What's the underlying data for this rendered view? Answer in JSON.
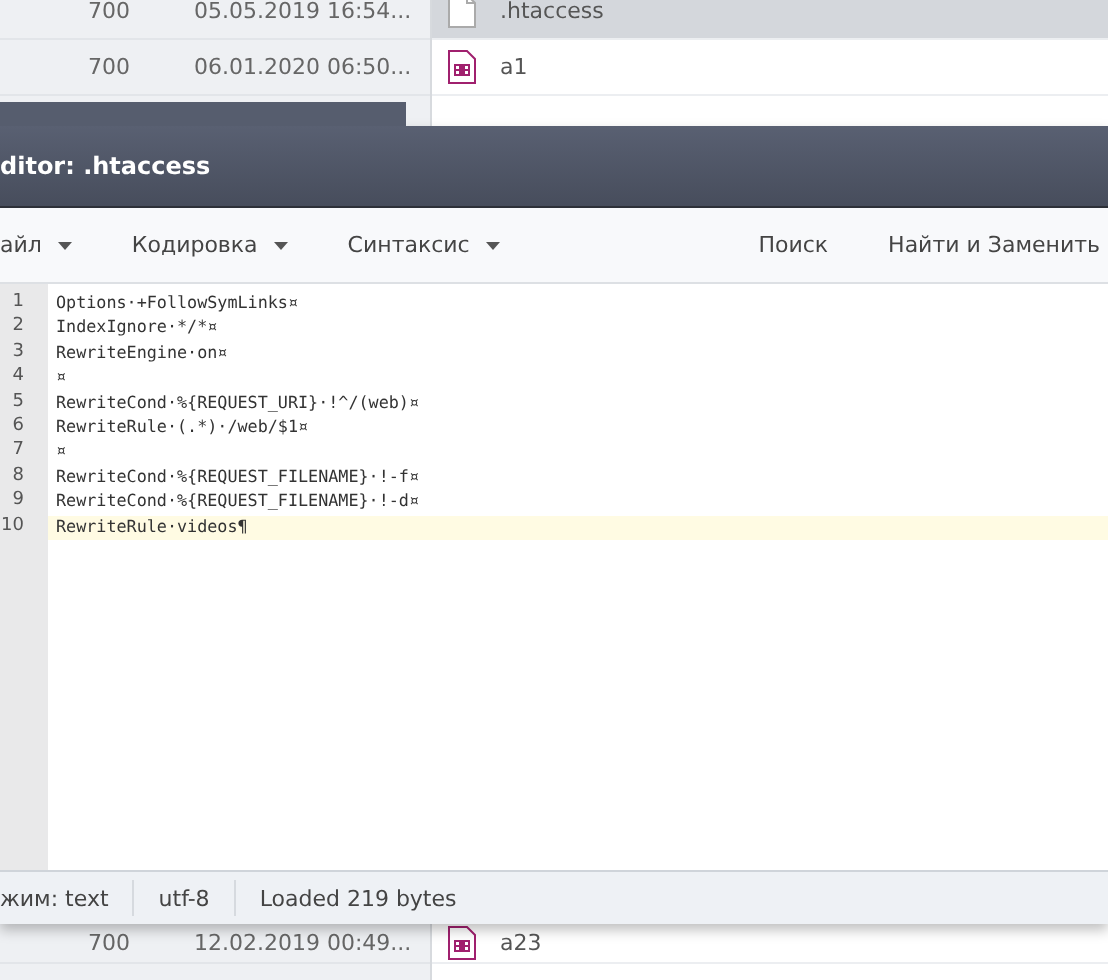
{
  "file_list": {
    "rows": [
      {
        "permissions": "700",
        "modified": "05.05.2019 16:54...",
        "name": ".htaccess",
        "kind": "document",
        "selected": true
      },
      {
        "permissions": "700",
        "modified": "06.01.2020 06:50...",
        "name": "a1",
        "kind": "video",
        "selected": false
      }
    ],
    "bottom_rows": [
      {
        "permissions": "700",
        "modified": "12.02.2019 00:49...",
        "name": "a23",
        "kind": "video",
        "selected": false
      }
    ]
  },
  "editor": {
    "title": "ditor: .htaccess",
    "menu": [
      {
        "label": "айл",
        "kind": "dropdown"
      },
      {
        "label": "Кодировка",
        "kind": "dropdown"
      },
      {
        "label": "Синтаксис",
        "kind": "dropdown"
      },
      {
        "label": "Поиск",
        "kind": "button"
      },
      {
        "label": "Найти и Заменить",
        "kind": "button"
      }
    ],
    "lines": [
      {
        "number": "1",
        "text": "Options·+FollowSymLinks¤",
        "current": false
      },
      {
        "number": "2",
        "text": "IndexIgnore·*/*¤",
        "current": false
      },
      {
        "number": "3",
        "text": "RewriteEngine·on¤",
        "current": false
      },
      {
        "number": "4",
        "text": "¤",
        "current": false
      },
      {
        "number": "5",
        "text": "RewriteCond·%{REQUEST_URI}·!^/(web)¤",
        "current": false
      },
      {
        "number": "6",
        "text": "RewriteRule·(.*)·/web/$1¤",
        "current": false
      },
      {
        "number": "7",
        "text": "¤",
        "current": false
      },
      {
        "number": "8",
        "text": "RewriteCond·%{REQUEST_FILENAME}·!-f¤",
        "current": false
      },
      {
        "number": "9",
        "text": "RewriteCond·%{REQUEST_FILENAME}·!-d¤",
        "current": false
      },
      {
        "number": "10",
        "text": "RewriteRule·videos¶",
        "current": true
      }
    ],
    "status_bar": [
      "жим: text",
      "utf-8",
      "Loaded 219 bytes"
    ]
  }
}
